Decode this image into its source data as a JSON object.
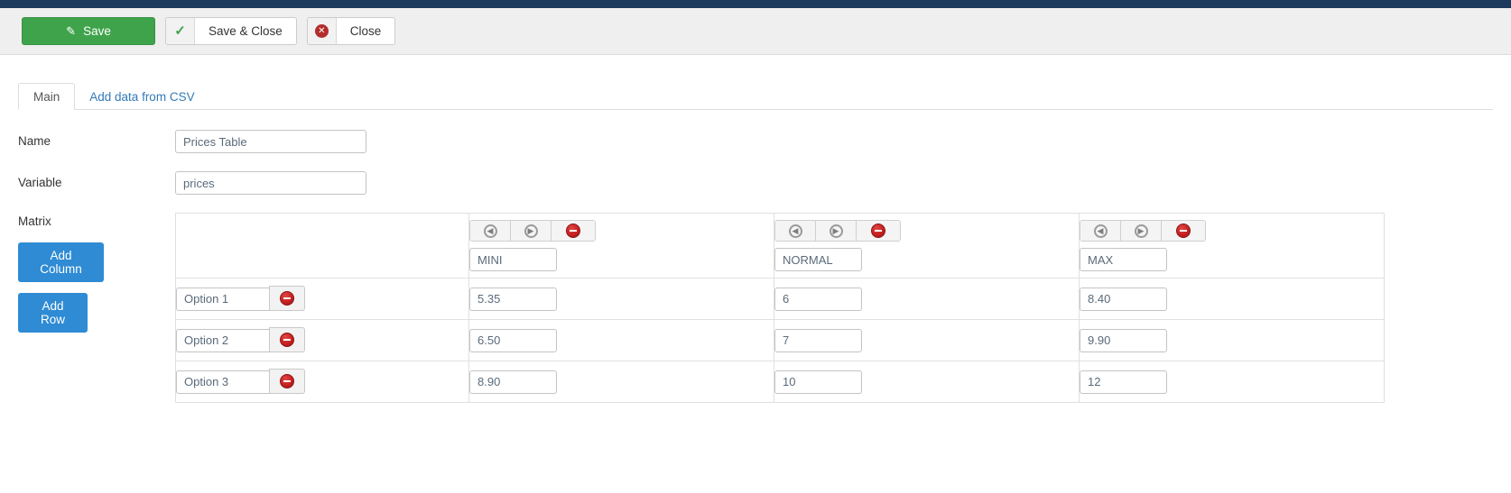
{
  "toolbar": {
    "save_label": "Save",
    "save_icon": "pencil-square-icon",
    "save_close_label": "Save & Close",
    "save_close_icon": "check-icon",
    "close_label": "Close",
    "close_icon": "circle-x-icon",
    "save_bg_color": "#3fa34b",
    "accent_blue": "#2e8bd4",
    "delete_red": "#c62121"
  },
  "tabs": [
    {
      "label": "Main",
      "active": true
    },
    {
      "label": "Add data from CSV",
      "active": false
    }
  ],
  "form": {
    "name": {
      "label": "Name",
      "value": "Prices Table"
    },
    "variable": {
      "label": "Variable",
      "value": "prices"
    }
  },
  "matrix": {
    "label": "Matrix",
    "add_column_label": "Add Column",
    "add_row_label": "Add Row",
    "column_controls": {
      "move_left_icon": "circle-chevron-left-icon",
      "move_right_icon": "circle-chevron-right-icon",
      "delete_icon": "circle-minus-icon"
    },
    "row_delete_icon": "circle-minus-icon",
    "columns": [
      {
        "header": "MINI"
      },
      {
        "header": "NORMAL"
      },
      {
        "header": "MAX"
      }
    ],
    "rows": [
      {
        "label": "Option 1",
        "values": [
          "5.35",
          "6",
          "8.40"
        ]
      },
      {
        "label": "Option 2",
        "values": [
          "6.50",
          "7",
          "9.90"
        ]
      },
      {
        "label": "Option 3",
        "values": [
          "8.90",
          "10",
          "12"
        ]
      }
    ]
  }
}
